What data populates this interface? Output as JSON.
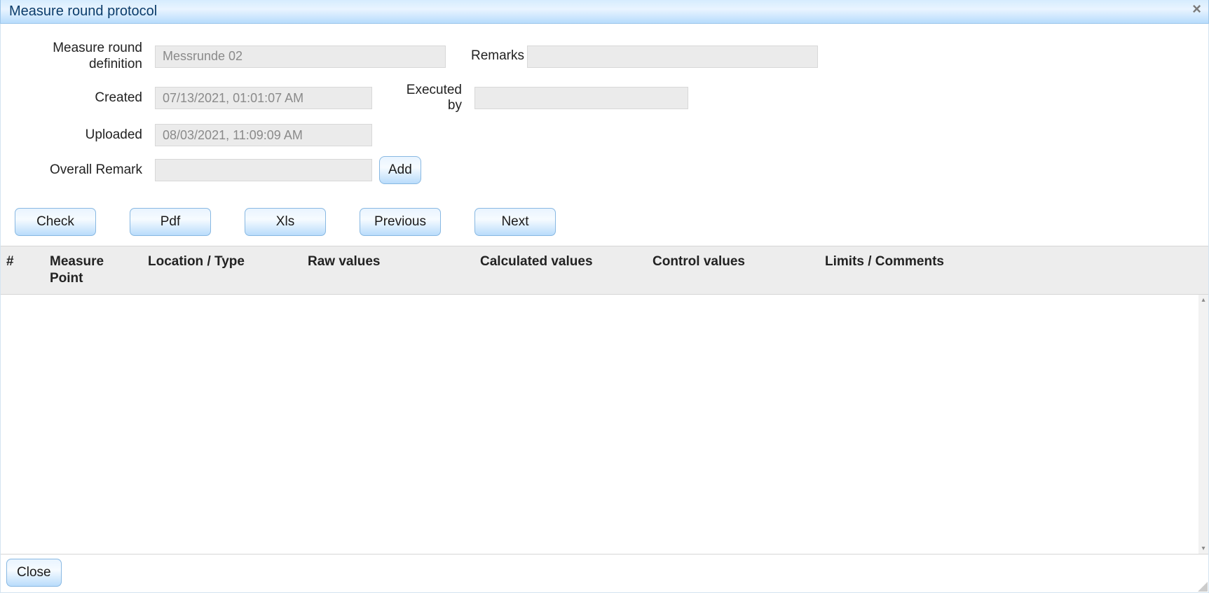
{
  "dialog": {
    "title": "Measure round protocol",
    "close_icon": "×"
  },
  "form": {
    "labels": {
      "definition_line1": "Measure round",
      "definition_line2": "definition",
      "created": "Created",
      "uploaded": "Uploaded",
      "overall_remark": "Overall Remark",
      "remarks": "Remarks",
      "executed_by": "Executed by"
    },
    "values": {
      "definition": "Messrunde 02",
      "created": "07/13/2021, 01:01:07 AM",
      "uploaded": "08/03/2021, 11:09:09 AM",
      "overall_remark": "",
      "remarks": "",
      "executed_by": ""
    },
    "buttons": {
      "add": "Add"
    }
  },
  "toolbar": {
    "check": "Check",
    "pdf": "Pdf",
    "xls": "Xls",
    "previous": "Previous",
    "next": "Next"
  },
  "table": {
    "columns": {
      "idx": "#",
      "measure_point": "Measure Point",
      "location_type": "Location / Type",
      "raw_values": "Raw values",
      "calculated_values": "Calculated values",
      "control_values": "Control values",
      "limits_comments": "Limits / Comments"
    },
    "rows": []
  },
  "footer": {
    "close": "Close"
  },
  "scroll": {
    "up": "▴",
    "down": "▾"
  }
}
